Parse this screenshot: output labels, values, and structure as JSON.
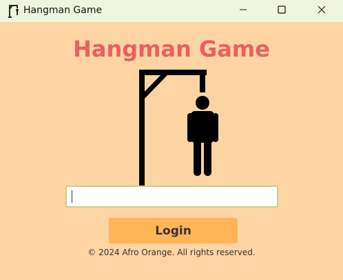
{
  "window": {
    "title": "Hangman Game",
    "app_icon": "gallows-icon",
    "controls": [
      "minimize-icon",
      "maximize-icon",
      "close-icon"
    ]
  },
  "main": {
    "heading": "Hangman Game",
    "illustration": "hangman-gallows-icon",
    "name_input": {
      "value": "",
      "placeholder": ""
    },
    "login_label": "Login",
    "footer": "© 2024 Afro Orange. All rights reserved."
  },
  "colors": {
    "background": "#fed4a3",
    "titlebar": "#eef7de",
    "heading": "#e86060",
    "button": "#ffb556",
    "input_border": "#c8d18a"
  }
}
